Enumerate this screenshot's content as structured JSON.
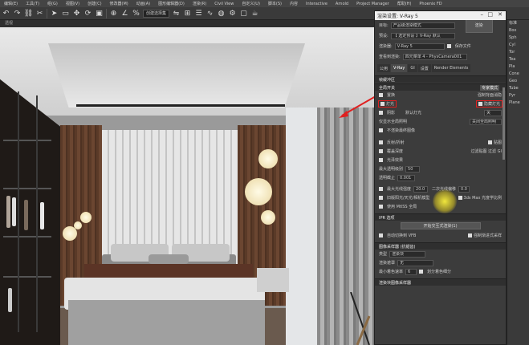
{
  "menubar": {
    "items": [
      "编辑(E)",
      "工具(T)",
      "组(G)",
      "视图(V)",
      "创建(C)",
      "修改器(M)",
      "动画(A)",
      "图形编辑器(D)",
      "渲染(R)",
      "Civil View",
      "自定义(U)",
      "脚本(S)",
      "内容",
      "Interactive",
      "Arnold",
      "Project Manager",
      "帮助(H)",
      "Phoenix FD"
    ]
  },
  "toolbar": {
    "selection_dropdown": "创建选择集",
    "icons": [
      "undo-icon",
      "redo-icon",
      "link-icon",
      "unlink-icon",
      "select-icon",
      "move-icon",
      "rotate-icon",
      "scale-icon",
      "snap-icon",
      "mirror-icon",
      "align-icon",
      "render-icon"
    ]
  },
  "viewport": {
    "label": "透视"
  },
  "dialog": {
    "title": "渲染设置: V-Ray 5",
    "target_label": "目标:",
    "target_value": "产品级渲染模式",
    "preset_label": "预设:",
    "preset_value": "【 选定预设 】V-Ray 默认",
    "renderer_label": "渲染器:",
    "renderer_value": "V-Ray 5",
    "save_file": "保存文件",
    "render_button": "渲染",
    "view_label": "查看到渲染:",
    "view_value": "四元菜单 4 - PhysCamera001",
    "tabs": [
      "公用",
      "V-Ray",
      "GI",
      "设置",
      "Render Elements"
    ],
    "frame_buffer": "帧缓冲区",
    "global_switches": "全局开关",
    "displacement": "置换",
    "mode": "专家模式",
    "force_back_face": "强制背面消隐",
    "lights": "灯光",
    "hidden_lights": "隐藏灯光",
    "shadows": "阴影",
    "default_lights": "默认灯光",
    "default_lights_value": "关",
    "only_gi": "仅显示全局照明",
    "only_gi_value": "关闭全局照明",
    "no_render_final": "不渲染最终图像",
    "reflection": "反射/折射",
    "maps": "贴图",
    "override_depth": "覆盖深度",
    "filter_maps": "过滤贴图",
    "filter_gi": "过滤 GI",
    "gloss_effects": "光泽效果",
    "max_transp": "最大透明级别",
    "max_transp_value": "50",
    "transp_cutoff": "透明截止",
    "transp_cutoff_value": "0.001",
    "max_ray_intensity": "最大光线强度",
    "max_ray_value": "20.0",
    "secondary_bias": "二次光线偏移",
    "secondary_bias_value": "0.0",
    "legacy_sun": "旧版阳光/天光/相机模型",
    "use_3dsmax_photometric": "3ds Max 光度学比例",
    "use_multi_cores": "使用 MtlSS 全局",
    "ipr_options": "IPR 选项",
    "ipr_start": "开始交互式渲染(1)",
    "sync_vfb": "自动切换到 VFB",
    "force_progressive": "强制渐进式采样",
    "image_sampler": "图像采样器 (抗锯齿)",
    "type_label": "类型",
    "type_value": "渲染块",
    "render_mask": "渲染遮罩",
    "render_mask_value": "无",
    "min_shading": "最小着色速率",
    "min_shading_value": "6",
    "divide_shading": "划分着色细分",
    "bucket_sampler": "渲染块图像采样器"
  },
  "right_panel": {
    "items": [
      "标准",
      "Box",
      "Sph",
      "Cyl",
      "Tor",
      "Tea",
      "Pla",
      "Cone",
      "Geo",
      "Tube",
      "Pyr",
      "Plane"
    ]
  }
}
